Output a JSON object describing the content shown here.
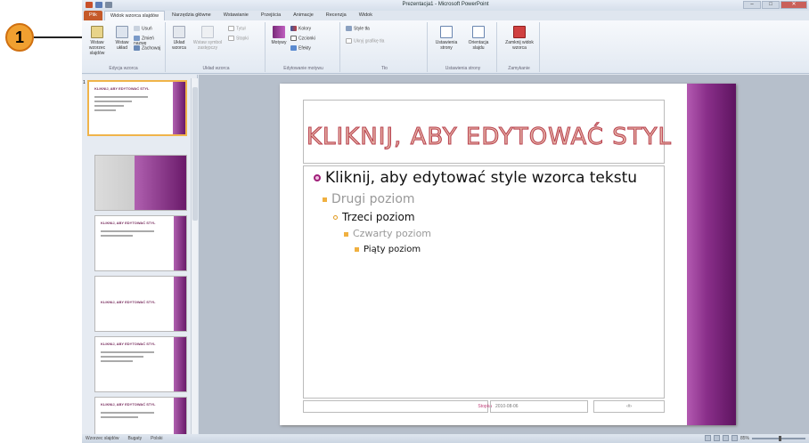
{
  "callout": {
    "number": "1"
  },
  "window": {
    "title": "Prezentacja1 - Microsoft PowerPoint"
  },
  "tabs": [
    {
      "label": "Plik",
      "kind": "file"
    },
    {
      "label": "Widok wzorca slajdów",
      "kind": "active"
    },
    {
      "label": "Narzędzia główne",
      "kind": ""
    },
    {
      "label": "Wstawianie",
      "kind": ""
    },
    {
      "label": "Przejścia",
      "kind": ""
    },
    {
      "label": "Animacje",
      "kind": ""
    },
    {
      "label": "Recenzja",
      "kind": ""
    },
    {
      "label": "Widok",
      "kind": ""
    }
  ],
  "ribbon": {
    "edit_master": {
      "label": "Edycja wzorca",
      "insert_slide_master": "Wstaw wzorzec slajdów",
      "insert_layout": "Wstaw układ",
      "delete": "Usuń",
      "rename": "Zmień nazwę",
      "preserve": "Zachowaj"
    },
    "master_layout": {
      "label": "Układ wzorca",
      "master_layout": "Układ wzorca",
      "insert_placeholder": "Wstaw symbol zastępczy",
      "title": "Tytuł",
      "footers": "Stopki"
    },
    "edit_theme": {
      "label": "Edytowanie motywu",
      "themes": "Motywy",
      "colors": "Kolory",
      "fonts": "Czcionki",
      "effects": "Efekty"
    },
    "background": {
      "label": "Tło",
      "background_styles": "Style tła",
      "hide_graphics": "Ukryj grafikę tła"
    },
    "page_setup": {
      "label": "Ustawienia strony",
      "page_setup": "Ustawienia strony",
      "orientation": "Orientacja slajdu"
    },
    "close": {
      "label": "Zamykanie",
      "close_master": "Zamknij widok wzorca"
    }
  },
  "slide": {
    "title": "KLIKNIJ, ABY EDYTOWAĆ STYL",
    "level1": "Kliknij, aby edytować style wzorca tekstu",
    "level2": "Drugi poziom",
    "level3": "Trzeci poziom",
    "level4": "Czwarty poziom",
    "level5": "Piąty poziom",
    "footer": "Stopka",
    "date": "2010-08-06",
    "slide_number": "‹#›"
  },
  "thumbnails": {
    "first_number": "1",
    "first_title": "KLIKNIJ, ABY EDYTOWAĆ STYL",
    "title_text": "KLIKNIJ, ABY EDYTOWAĆ STYL"
  },
  "status": {
    "view": "Wzorzec slajdów",
    "theme": "Bugaty",
    "language": "Polski",
    "zoom": "85%"
  }
}
